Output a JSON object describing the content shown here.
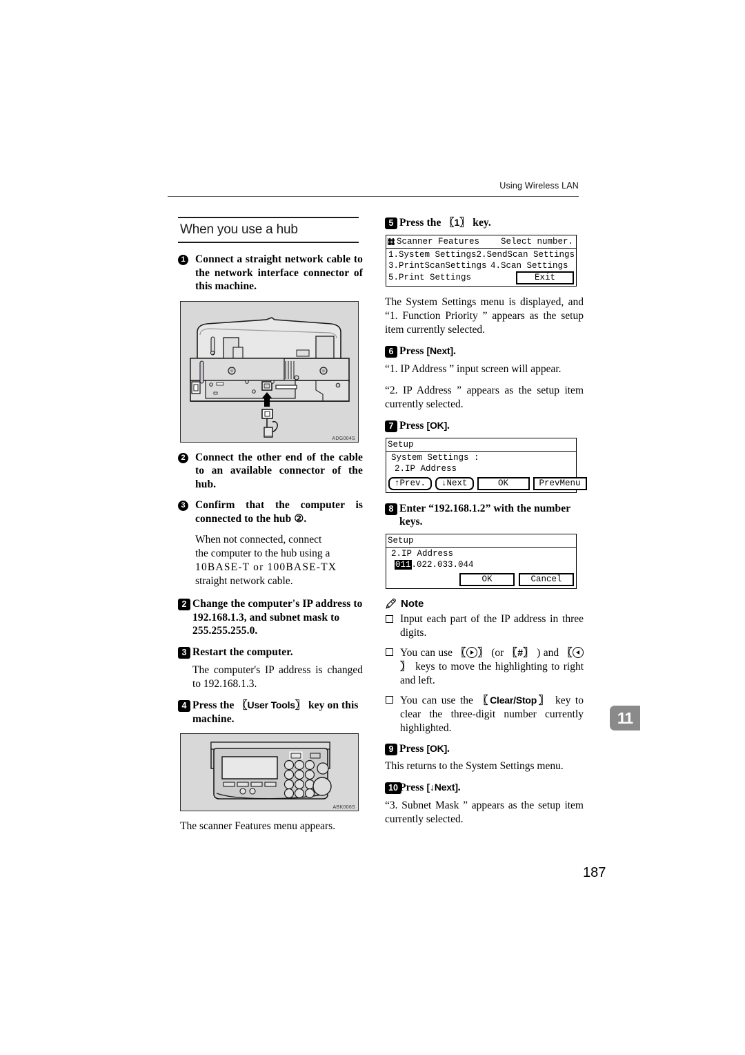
{
  "header": {
    "running_title": "Using Wireless LAN"
  },
  "folio": "187",
  "chapter_tab": "11",
  "left_column": {
    "section_title": "When you use a hub",
    "steps": [
      {
        "badge": "1",
        "badge_style": "circle",
        "text": "Connect a straight network cable to the network interface connector of this machine."
      },
      {
        "badge": "2",
        "badge_style": "circle",
        "text": "Connect the other end of the cable to an available connector of the hub."
      },
      {
        "badge": "3",
        "badge_style": "circle",
        "text": "Confirm that the computer is connected to the hub ②."
      }
    ],
    "illustration_1_code": "ADG004S",
    "paragraph_not_connected_line1": "When not connected, connect",
    "paragraph_not_connected_line2": "the computer to the hub using a",
    "paragraph_not_connected_line3": "10BASE-T or 100BASE-TX",
    "paragraph_not_connected_line4": "straight network cable.",
    "step_2": {
      "badge": "2",
      "text": "Change the computer's IP address to 192.168.1.3, and subnet mask to 255.255.255.0."
    },
    "step_3": {
      "badge": "3",
      "text": "Restart the computer."
    },
    "step_3_result": "The computer's IP address is changed to 192.168.1.3.",
    "step_4": {
      "badge": "4",
      "text_before_key": "Press the ",
      "key_label": "User Tools",
      "text_after_key": " key on this machine."
    },
    "illustration_2_code": "ABK006S",
    "step_4_result": "The scanner Features menu appears."
  },
  "right_column": {
    "step_5": {
      "badge": "5",
      "text_before_key": "Press the ",
      "key_label": "1",
      "text_after_key": " key."
    },
    "lcd_scanner_features": {
      "title": "Scanner Features",
      "title_right": "Select number.",
      "rows": [
        [
          "1.System Settings",
          "2.SendScan Settings"
        ],
        [
          "3.PrintScanSettings",
          "4.Scan Settings"
        ]
      ],
      "last_row_left": "5.Print Settings",
      "exit_button": "Exit"
    },
    "step_5_result": "The System Settings menu is displayed, and “1. Function Priority ” appears as the setup item currently selected.",
    "step_6": {
      "badge": "6",
      "text_before_key": "Press ",
      "key_label": "Next",
      "text_after_key": "."
    },
    "step_6_result_1": "“1. IP Address ” input screen will appear.",
    "step_6_result_2": "“2. IP Address ” appears as the setup item currently selected.",
    "step_7": {
      "badge": "7",
      "text_before_key": "Press ",
      "key_label": "OK",
      "text_after_key": "."
    },
    "lcd_setup_menu": {
      "title": "Setup",
      "line1": "System Settings :",
      "line2": "2.IP Address",
      "buttons": [
        "↑Prev.",
        "↓Next",
        "OK",
        "PrevMenu"
      ]
    },
    "step_8": {
      "badge": "8",
      "text": "Enter “192.168.1.2” with the number keys."
    },
    "lcd_ip_input": {
      "title": "Setup",
      "line1": "2.IP Address",
      "highlighted_octet": "011",
      "remaining_octets": ".022.033.044",
      "buttons": [
        "OK",
        "Cancel"
      ]
    },
    "note": {
      "heading": "Note",
      "items": [
        {
          "kind": "text",
          "text": "Input each part of the IP address in three digits."
        },
        {
          "kind": "keys",
          "part1": "You can use ",
          "key_right": "▶",
          "part2": " (or ",
          "key_hash": "#",
          "part3": " ) and ",
          "key_left": "◀",
          "part4": " keys to move the highlighting to right and left."
        },
        {
          "kind": "clear",
          "part1": "You can use the ",
          "key_label": "Clear/Stop",
          "part2": " key to clear the three-digit number currently highlighted."
        }
      ]
    },
    "step_9": {
      "badge": "9",
      "text_before_key": "Press ",
      "key_label": "OK",
      "text_after_key": "."
    },
    "step_9_result": "This returns to the System Settings menu.",
    "step_10": {
      "badge": "10",
      "text_before_key": "Press ",
      "key_label": "↓Next",
      "text_after_key": "."
    },
    "step_10_result": "“3. Subnet Mask ” appears as the setup item currently selected."
  }
}
